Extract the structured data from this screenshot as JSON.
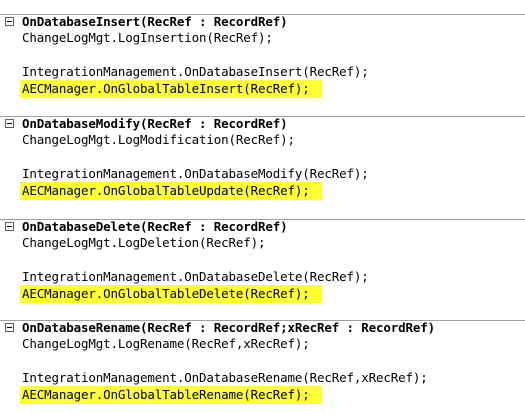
{
  "triggers": [
    {
      "signature": "OnDatabaseInsert(RecRef : RecordRef)",
      "lines": [
        "ChangeLogMgt.LogInsertion(RecRef);",
        "",
        "IntegrationManagement.OnDatabaseInsert(RecRef);",
        "AECManager.OnGlobalTableInsert(RecRef);"
      ]
    },
    {
      "signature": "OnDatabaseModify(RecRef : RecordRef)",
      "lines": [
        "ChangeLogMgt.LogModification(RecRef);",
        "",
        "IntegrationManagement.OnDatabaseModify(RecRef);",
        "AECManager.OnGlobalTableUpdate(RecRef);"
      ]
    },
    {
      "signature": "OnDatabaseDelete(RecRef : RecordRef)",
      "lines": [
        "ChangeLogMgt.LogDeletion(RecRef);",
        "",
        "IntegrationManagement.OnDatabaseDelete(RecRef);",
        "AECManager.OnGlobalTableDelete(RecRef);"
      ]
    },
    {
      "signature": "OnDatabaseRename(RecRef : RecordRef;xRecRef : RecordRef)",
      "lines": [
        "ChangeLogMgt.LogRename(RecRef,xRecRef);",
        "",
        "IntegrationManagement.OnDatabaseRename(RecRef,xRecRef);",
        "AECManager.OnGlobalTableRename(RecRef);"
      ]
    }
  ],
  "highlight_color": "#ffff33"
}
